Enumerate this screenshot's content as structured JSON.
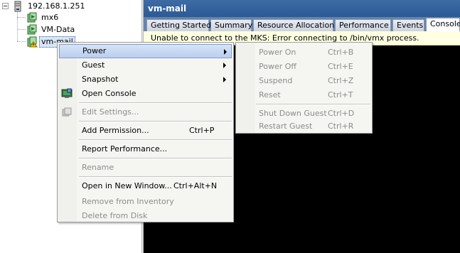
{
  "tree": {
    "host": "192.168.1.251",
    "vms": [
      {
        "label": "mx6"
      },
      {
        "label": "VM-Data"
      },
      {
        "label": "vm-mail"
      }
    ]
  },
  "right_pane": {
    "title": "vm-mail",
    "tabs": [
      "Getting Started",
      "Summary",
      "Resource Allocation",
      "Performance",
      "Events",
      "Console"
    ],
    "active_tab": "Console",
    "error": "Unable to connect to the MKS: Error connecting to /bin/vmx process."
  },
  "context_menu": {
    "items": [
      {
        "label": "Power",
        "submenu": true
      },
      {
        "label": "Guest",
        "submenu": true
      },
      {
        "label": "Snapshot",
        "submenu": true
      },
      {
        "label": "Open Console"
      },
      {
        "label": "Edit Settings..."
      },
      {
        "label": "Add Permission...",
        "shortcut": "Ctrl+P"
      },
      {
        "label": "Report Performance..."
      },
      {
        "label": "Rename"
      },
      {
        "label": "Open in New Window...",
        "shortcut": "Ctrl+Alt+N"
      },
      {
        "label": "Remove from Inventory"
      },
      {
        "label": "Delete from Disk"
      }
    ]
  },
  "power_submenu": {
    "items": [
      {
        "label": "Power On",
        "shortcut": "Ctrl+B"
      },
      {
        "label": "Power Off",
        "shortcut": "Ctrl+E"
      },
      {
        "label": "Suspend",
        "shortcut": "Ctrl+Z"
      },
      {
        "label": "Reset",
        "shortcut": "Ctrl+T"
      },
      {
        "label": "Shut Down Guest",
        "shortcut": "Ctrl+D"
      },
      {
        "label": "Restart Guest",
        "shortcut": "Ctrl+R"
      }
    ]
  },
  "icons": {
    "host": "server-icon",
    "vm": "virtual-machine-icon",
    "vm_warning": "virtual-machine-warning-icon",
    "console": "open-console-icon",
    "settings": "edit-settings-icon"
  },
  "colors": {
    "title_bar": "#2b5a94",
    "tab_strip": "#6584ad",
    "error_bar": "#ffffe1",
    "menu_highlight": "#c7d8f2",
    "console_bg": "#000000"
  }
}
